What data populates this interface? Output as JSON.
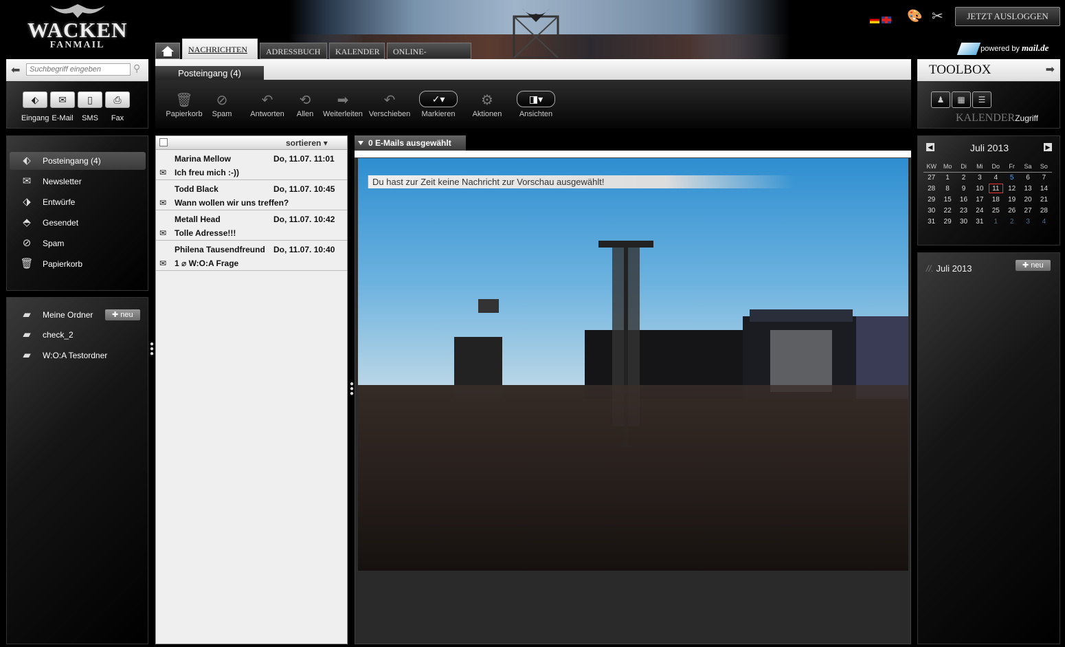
{
  "header": {
    "logo_line1": "WACKEN",
    "logo_line2": "FANMAIL",
    "logout_label": "JETZT AUSLOGGEN",
    "powered_prefix": "powered by",
    "powered_brand": "mail.de",
    "flags": [
      "de-flag",
      "uk-flag"
    ]
  },
  "tabs": [
    {
      "label": "NACHRICHTEN",
      "active": true
    },
    {
      "label": "ADRESSBUCH",
      "active": false
    },
    {
      "label": "KALENDER",
      "active": false
    },
    {
      "label": "ONLINE-SPEICHER",
      "active": false
    }
  ],
  "search": {
    "placeholder": "Suchbegriff eingeben"
  },
  "compose": {
    "items": [
      "Eingang",
      "E-Mail",
      "SMS",
      "Fax"
    ]
  },
  "toolbar": {
    "folder_tab": "Posteingang (4)",
    "buttons": [
      "Papierkorb",
      "Spam",
      "Antworten",
      "Allen",
      "Weiterleiten",
      "Verschieben",
      "Markieren",
      "Aktionen",
      "Ansichten"
    ]
  },
  "folders": [
    {
      "label": "Posteingang (4)",
      "icon": "inbox-icon",
      "selected": true
    },
    {
      "label": "Newsletter",
      "icon": "newsletter-icon",
      "selected": false
    },
    {
      "label": "Entwürfe",
      "icon": "drafts-icon",
      "selected": false
    },
    {
      "label": "Gesendet",
      "icon": "sent-icon",
      "selected": false
    },
    {
      "label": "Spam",
      "icon": "spam-icon",
      "selected": false
    },
    {
      "label": "Papierkorb",
      "icon": "trash-icon",
      "selected": false
    }
  ],
  "my_folders": {
    "title": "Meine Ordner",
    "new_label": "neu",
    "items": [
      "check_2",
      "W:O:A Testordner"
    ]
  },
  "mail_list": {
    "sort_label": "sortieren",
    "messages": [
      {
        "from": "Marina Mellow",
        "date": "Do, 11.07. 11:01",
        "subject": "Ich freu mich :-))"
      },
      {
        "from": "Todd Black",
        "date": "Do, 11.07. 10:45",
        "subject": "Wann wollen wir uns treffen?"
      },
      {
        "from": "Metall Head",
        "date": "Do, 11.07. 10:42",
        "subject": "Tolle Adresse!!!"
      },
      {
        "from": "Philena Tausendfreund",
        "date": "Do, 11.07. 10:40",
        "subject": "1 ⌀ W:O:A Frage"
      }
    ]
  },
  "preview": {
    "tab_label": "0 E-Mails ausgewählt",
    "empty_message": "Du hast zur Zeit keine Nachricht zur Vorschau ausgewählt!"
  },
  "toolbox": {
    "title": "TOOLBOX",
    "section_label": "KALENDER",
    "section_suffix": "Zugriff"
  },
  "calendar": {
    "month": "Juli 2013",
    "headers": [
      "KW",
      "Mo",
      "Di",
      "Mi",
      "Do",
      "Fr",
      "Sa",
      "So"
    ],
    "rows": [
      [
        "27",
        "1",
        "2",
        "3",
        "4",
        "5",
        "6",
        "7"
      ],
      [
        "28",
        "8",
        "9",
        "10",
        "11",
        "12",
        "13",
        "14"
      ],
      [
        "29",
        "15",
        "16",
        "17",
        "18",
        "19",
        "20",
        "21"
      ],
      [
        "30",
        "22",
        "23",
        "24",
        "25",
        "26",
        "27",
        "28"
      ],
      [
        "31",
        "29",
        "30",
        "31",
        "1",
        "2",
        "3",
        "4"
      ]
    ],
    "today": "11"
  },
  "events": {
    "title": "Juli 2013",
    "new_label": "neu"
  }
}
